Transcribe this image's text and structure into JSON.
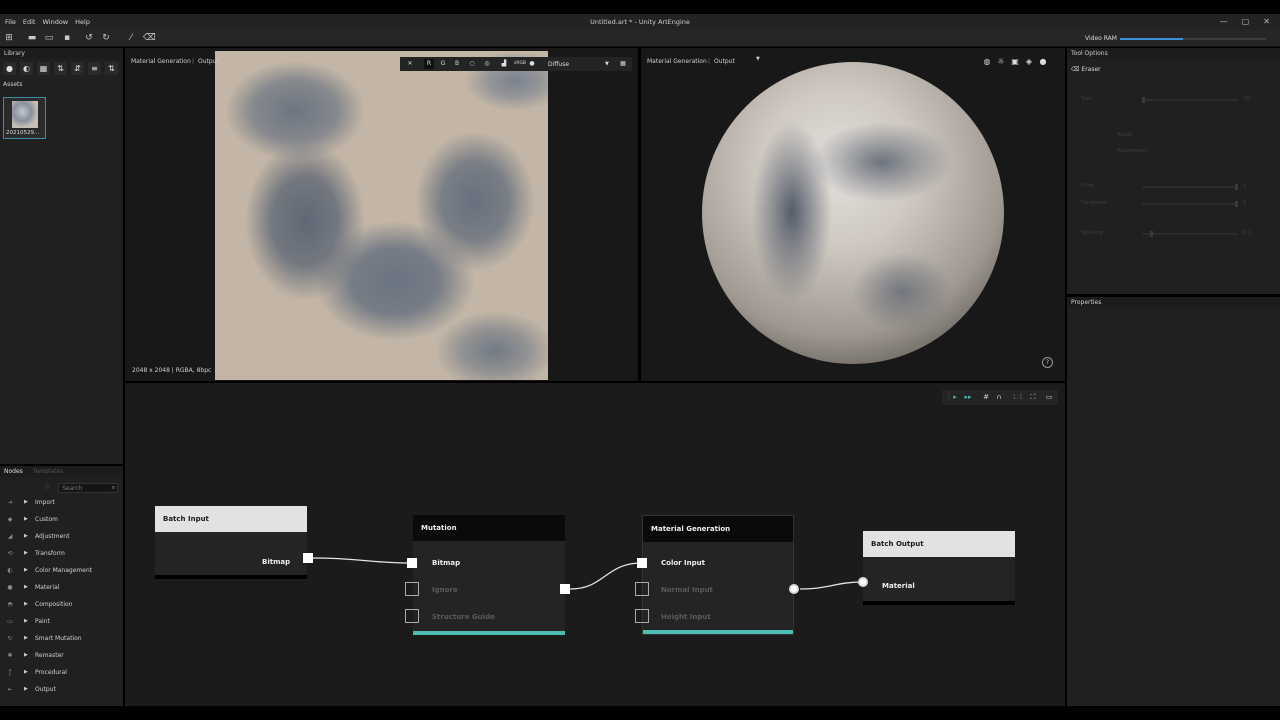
{
  "window": {
    "title": "Untitled.art * - Unity ArtEngine",
    "menu": [
      "File",
      "Edit",
      "Window",
      "Help"
    ],
    "controls": [
      "—",
      "▢",
      "✕"
    ]
  },
  "toolbar": {
    "icons": [
      "graph-icon",
      "new-icon",
      "open-icon",
      "save-icon",
      "undo-icon",
      "redo-icon",
      "brush-icon",
      "eraser-icon"
    ],
    "vram_label": "Video RAM",
    "vram_usage": 0.43
  },
  "library": {
    "title": "Library",
    "assets_label": "Assets",
    "asset_name": "20210529..."
  },
  "nodes_panel": {
    "tabs": [
      "Nodes",
      "Templates"
    ],
    "search_placeholder": "Search",
    "categories": [
      "Import",
      "Custom",
      "Adjustment",
      "Transform",
      "Color Management",
      "Material",
      "Composition",
      "Paint",
      "Smart Mutation",
      "Remaster",
      "Procedural",
      "Output"
    ]
  },
  "viewport_2d": {
    "breadcrumb_1": "Material Generation",
    "breadcrumb_2": "Output",
    "channels": [
      "R",
      "G",
      "B"
    ],
    "channel_value": "sRGB",
    "map_select": "Diffuse",
    "info": "2048 x 2048 | RGBA, 8bpc"
  },
  "viewport_3d": {
    "breadcrumb_1": "Material Generation",
    "breadcrumb_2": "Output"
  },
  "tool_options": {
    "title": "Tool Options",
    "tool": "Eraser",
    "size_label": "Size",
    "size_value": "20",
    "angle_label": "Angle",
    "roundness_label": "Roundness",
    "flow_label": "Flow",
    "flow_value": "1",
    "hardness_label": "Hardness",
    "hardness_value": "1",
    "spacing_label": "Spacing",
    "spacing_value": "0.2"
  },
  "properties": {
    "title": "Properties"
  },
  "graph": {
    "nodes": {
      "batch_input": {
        "title": "Batch Input",
        "ports": [
          "Bitmap"
        ]
      },
      "mutation": {
        "title": "Mutation",
        "ports": [
          "Bitmap",
          "Ignore",
          "Structure Guide"
        ]
      },
      "material_generation": {
        "title": "Material Generation",
        "ports": [
          "Color Input",
          "Normal Input",
          "Height Input"
        ]
      },
      "batch_output": {
        "title": "Batch Output",
        "ports": [
          "Material"
        ]
      }
    }
  }
}
